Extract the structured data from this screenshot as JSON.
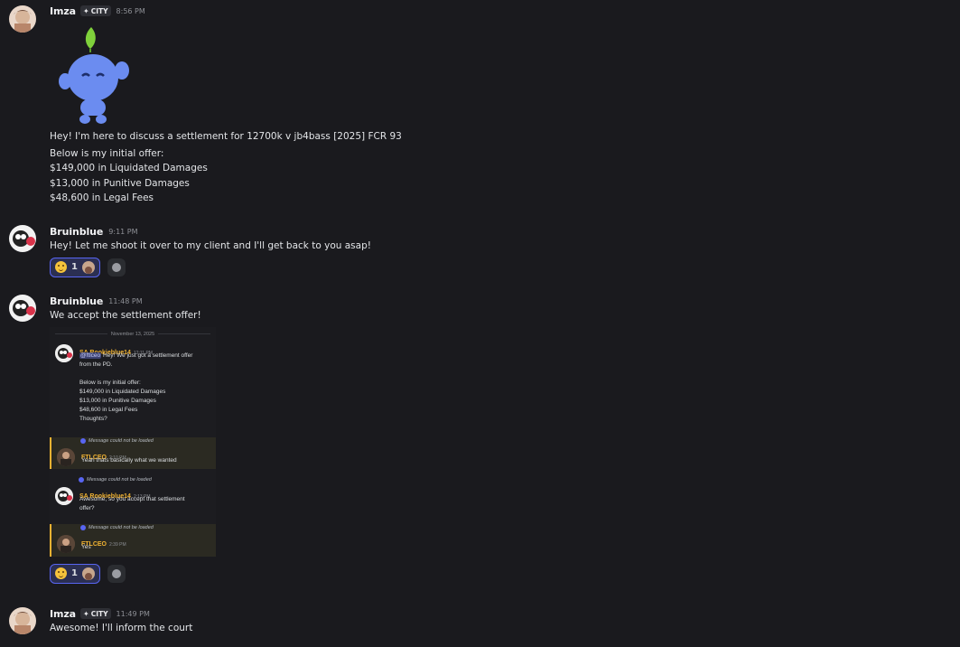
{
  "messages": [
    {
      "author": "Imza",
      "tag": "CITY",
      "time": "8:56 PM",
      "sticker": "blue-mascot-sticker",
      "lines": [
        "Hey! I'm here to discuss a settlement for 12700k v jb4bass [2025] FCR 93",
        "Below is my initial offer:",
        "$149,000 in Liquidated Damages",
        "$13,000 in Punitive Damages",
        "$48,600 in Legal Fees"
      ]
    },
    {
      "author": "Bruinblue",
      "time": "9:11 PM",
      "lines": [
        "Hey! Let me shoot it over to my client and I'll get back to you asap!"
      ],
      "reaction": {
        "emoji": "slightly-smiling-face",
        "count": "1"
      }
    },
    {
      "author": "Bruinblue",
      "time": "11:48 PM",
      "lines": [
        "We accept the settlement offer!"
      ],
      "reaction": {
        "emoji": "slightly-smiling-face",
        "count": "1"
      }
    },
    {
      "author": "Imza",
      "tag": "CITY",
      "time": "11:49 PM",
      "lines": [
        "Awesome! I'll inform the court"
      ]
    }
  ],
  "embedded_screenshot": {
    "date_divider": "November 13, 2025",
    "m1": {
      "author": "SA Rookieblue14",
      "time": "12:11 PM",
      "mention": "@ftlceo",
      "lines": [
        "Hey! We just got a settlement offer",
        "from the PD.",
        "",
        "Below is my initial offer:",
        "$149,000 in Liquidated Damages",
        "$13,000 in Punitive Damages",
        "$48,600 in Legal Fees",
        "Thoughts?"
      ]
    },
    "unloaded": "Message could not be loaded",
    "m2": {
      "author": "FTLCEO",
      "time": "2:10 PM",
      "text": "Yeah thats basically what we wanted"
    },
    "m3": {
      "author": "SA Rookieblue14",
      "time": "2:13 PM",
      "lines": [
        "Awesome, so you accept that settlement",
        "offer?"
      ]
    },
    "m4": {
      "author": "FTLCEO",
      "time": "2:39 PM",
      "text": "Yes"
    }
  },
  "colors": {
    "background": "#1a1a1e",
    "accent": "#5865f2",
    "name_gold": "#f0b232"
  }
}
